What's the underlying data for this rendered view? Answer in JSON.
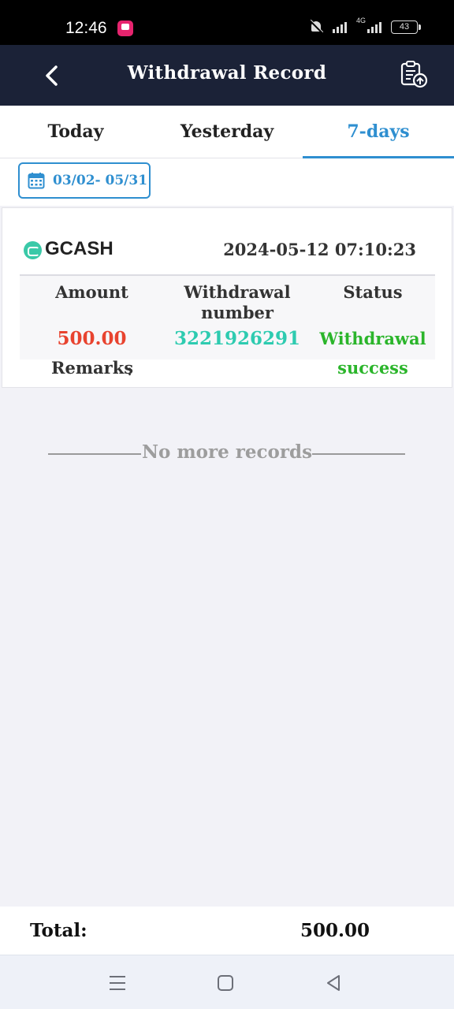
{
  "status_bar": {
    "time": "12:46",
    "network": "4G",
    "battery": "43",
    "icons": [
      "app-notification-icon",
      "bell-off-icon",
      "signal-icon",
      "signal-4g-icon",
      "battery-icon"
    ]
  },
  "header": {
    "title": "Withdrawal Record",
    "back_icon": "chevron-left-icon",
    "action_icon": "clipboard-upload-icon"
  },
  "tabs": [
    {
      "label": "Today",
      "active": false
    },
    {
      "label": "Yesterday",
      "active": false
    },
    {
      "label": "7-days",
      "active": true
    }
  ],
  "date_filter": {
    "range": "03/02- 05/31",
    "icon": "calendar-icon"
  },
  "record": {
    "channel": "GCASH",
    "channel_icon": "gcash-logo-icon",
    "datetime": "2024-05-12 07:10:23",
    "columns": {
      "amount": "Amount",
      "number": "Withdrawal number",
      "status": "Status"
    },
    "amount": "500.00",
    "withdrawal_number": "3221926291",
    "status_line1": "Withdrawal",
    "status_line2": "success",
    "remarks_label": "Remarks",
    "remarks_colon": ":"
  },
  "list_end": "No more records",
  "footer": {
    "total_label": "Total:",
    "total_value": "500.00"
  },
  "nav": {
    "icons": [
      "menu-icon",
      "home-icon",
      "back-icon"
    ]
  },
  "colors": {
    "header_bg": "#1b2237",
    "accent": "#2f8fd0",
    "amount": "#e8432f",
    "number": "#2ecbb0",
    "status": "#2bb52b"
  }
}
